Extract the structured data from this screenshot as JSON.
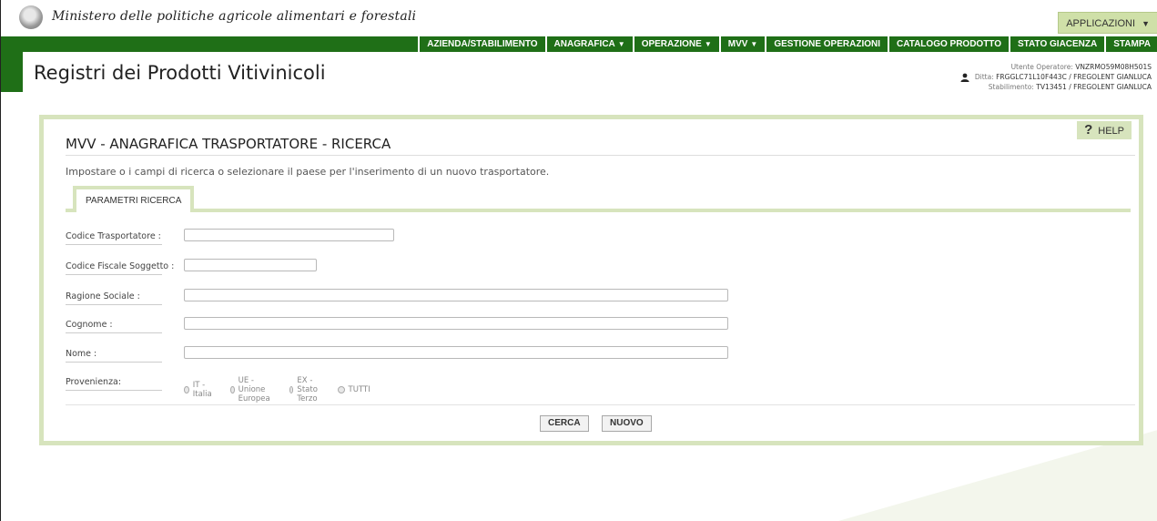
{
  "ministry": {
    "title": "Ministero delle politiche agricole alimentari e forestali",
    "emblem_icon": "italian-republic-emblem-icon"
  },
  "app_menu": {
    "label": "APPLICAZIONI",
    "caret": "▼"
  },
  "nav": {
    "items": [
      {
        "label": "AZIENDA/STABILIMENTO",
        "caret": ""
      },
      {
        "label": "ANAGRAFICA",
        "caret": "▼"
      },
      {
        "label": "OPERAZIONE",
        "caret": "▼"
      },
      {
        "label": "MVV",
        "caret": "▼"
      },
      {
        "label": "GESTIONE OPERAZIONI",
        "caret": ""
      },
      {
        "label": "CATALOGO PRODOTTO",
        "caret": ""
      },
      {
        "label": "STATO GIACENZA",
        "caret": ""
      },
      {
        "label": "STAMPA",
        "caret": ""
      }
    ]
  },
  "app_title": "Registri dei Prodotti Vitivinicoli",
  "user": {
    "operator_label": "Utente Operatore:",
    "operator_value": "VNZRMO59M08H501S",
    "ditta_label": "Ditta:",
    "ditta_value": "FRGGLC71L10F443C / FREGOLENT GIANLUCA",
    "stabilimento_label": "Stabilimento:",
    "stabilimento_value": "TV13451 / FREGOLENT GIANLUCA",
    "icon": "user-icon"
  },
  "panel": {
    "help_label": "HELP",
    "help_icon": "?",
    "title": "MVV - ANAGRAFICA TRASPORTATORE - RICERCA",
    "instructions": "Impostare o i campi di ricerca o selezionare il paese per l'inserimento di un nuovo trasportatore.",
    "tab_label": "PARAMETRI RICERCA"
  },
  "form": {
    "codice_trasportatore": {
      "label": "Codice Trasportatore :",
      "value": ""
    },
    "codice_fiscale": {
      "label": "Codice Fiscale Soggetto :",
      "value": ""
    },
    "ragione_sociale": {
      "label": "Ragione Sociale :",
      "value": ""
    },
    "cognome": {
      "label": "Cognome :",
      "value": ""
    },
    "nome": {
      "label": "Nome :",
      "value": ""
    },
    "provenienza": {
      "label": "Provenienza:",
      "options": [
        "IT - Italia",
        "UE - Unione Europea",
        "EX - Stato Terzo",
        "TUTTI"
      ],
      "selected": null
    }
  },
  "buttons": {
    "search": "CERCA",
    "new": "NUOVO"
  },
  "colors": {
    "nav_green": "#1f6f17",
    "panel_border": "#d7e4bd",
    "app_menu_bg": "#cfe0a8"
  }
}
